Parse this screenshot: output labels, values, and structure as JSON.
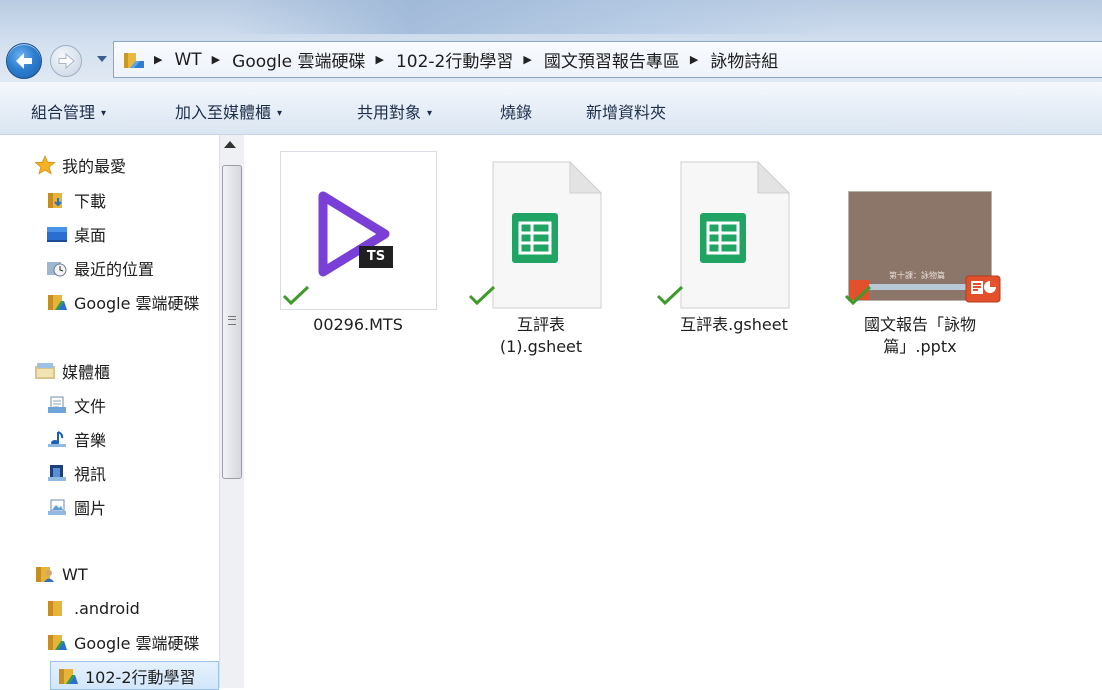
{
  "address_bar": {
    "breadcrumbs": [
      "WT",
      "Google 雲端硬碟",
      "102-2行動學習",
      "國文預習報告專區",
      "詠物詩組"
    ],
    "separator": "▶"
  },
  "toolbar": {
    "items": [
      {
        "label": "組合管理",
        "dropdown": "▾"
      },
      {
        "label": "加入至媒體櫃",
        "dropdown": "▾"
      },
      {
        "label": "共用對象",
        "dropdown": "▾"
      },
      {
        "label": "燒錄"
      },
      {
        "label": "新增資料夾"
      }
    ]
  },
  "nav_pane": {
    "favorites": {
      "label": "我的最愛",
      "items": [
        "下載",
        "桌面",
        "最近的位置",
        "Google 雲端硬碟"
      ]
    },
    "libraries": {
      "label": "媒體櫃",
      "items": [
        "文件",
        "音樂",
        "視訊",
        "圖片"
      ]
    },
    "user": {
      "label": "WT",
      "items": [
        ".android",
        "Google 雲端硬碟",
        "102-2行動學習"
      ]
    }
  },
  "files": [
    {
      "line1": "00296.MTS",
      "line2": "",
      "badge": "TS",
      "type": "video",
      "synced": true
    },
    {
      "line1": "互評表",
      "line2": "(1).gsheet",
      "type": "gsheet",
      "synced": true
    },
    {
      "line1": "互評表.gsheet",
      "line2": "",
      "type": "gsheet",
      "synced": true
    },
    {
      "line1": "國文報告「詠物",
      "line2": "篇」.pptx",
      "type": "pptx",
      "slide_text": "第十課：詠物篇",
      "synced": true
    }
  ],
  "colors": {
    "sync_check": "#3e9a2a",
    "sheets_green": "#1fa463",
    "video_purple": "#7a3fd6",
    "pptx_orange": "#e2512c"
  }
}
